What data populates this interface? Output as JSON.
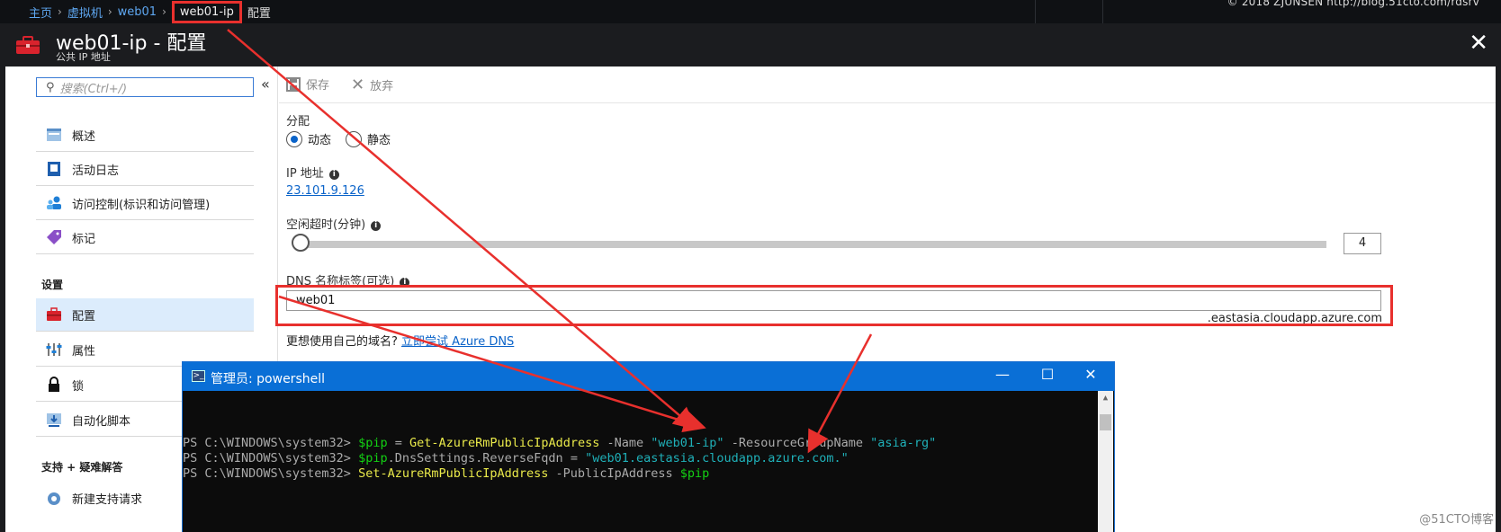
{
  "breadcrumb": {
    "items": [
      "主页",
      "虚拟机",
      "web01"
    ],
    "current": "web01-ip",
    "last": "配置"
  },
  "copyright": "© 2018 ZJUNSEN http://blog.51cto.com/rdsrv",
  "header": {
    "title": "web01-ip - 配置",
    "subtitle": "公共 IP 地址"
  },
  "sidebar": {
    "search_placeholder": "搜索(Ctrl+/)",
    "items": [
      {
        "label": "概述"
      },
      {
        "label": "活动日志"
      },
      {
        "label": "访问控制(标识和访问管理)"
      },
      {
        "label": "标记"
      }
    ],
    "section_settings": "设置",
    "settings_items": [
      {
        "label": "配置"
      },
      {
        "label": "属性"
      },
      {
        "label": "锁"
      },
      {
        "label": "自动化脚本"
      }
    ],
    "section_support": "支持 + 疑难解答",
    "support_items": [
      {
        "label": "新建支持请求"
      }
    ]
  },
  "toolbar": {
    "save_label": "保存",
    "discard_label": "放弃"
  },
  "form": {
    "allocation_label": "分配",
    "dynamic_label": "动态",
    "static_label": "静态",
    "allocation_selected": "动态",
    "ip_label": "IP 地址",
    "ip_value": "23.101.9.126",
    "idle_label": "空闲超时(分钟)",
    "idle_value": "4",
    "idle_fraction": 0.0,
    "dns_label": "DNS 名称标签(可选)",
    "dns_value": "web01",
    "dns_suffix": ".eastasia.cloudapp.azure.com",
    "hint_text": "更想使用自己的域名?",
    "hint_link": "立即尝试 Azure DNS"
  },
  "powershell": {
    "title": "管理员: powershell",
    "lines": [
      {
        "prompt": "PS C:\\WINDOWS\\system32> ",
        "cmd": "$pip = Get-AzureRmPublicIpAddress -Name \"web01-ip\" -ResourceGroupName \"asia-rg\""
      },
      {
        "prompt": "PS C:\\WINDOWS\\system32> ",
        "cmd": "$pip.DnsSettings.ReverseFqdn = \"web01.eastasia.cloudapp.azure.com.\""
      },
      {
        "prompt": "PS C:\\WINDOWS\\system32> ",
        "cmd": "Set-AzureRmPublicIpAddress -PublicIpAddress $pip"
      }
    ]
  },
  "watermark": "@51CTO博客",
  "colors": {
    "accent": "#0a63c9",
    "highlight": "#e8302d",
    "ps_titlebar": "#0a6fd6"
  }
}
